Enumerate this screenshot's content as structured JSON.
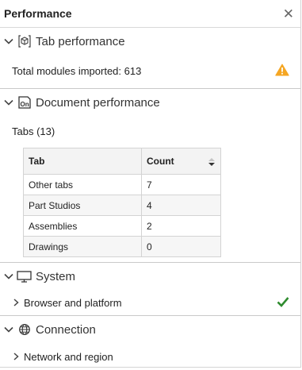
{
  "header": {
    "title": "Performance",
    "close_glyph": "✕"
  },
  "sections": {
    "tab_performance": {
      "label": "Tab performance",
      "modules_text": "Total modules imported: 613",
      "warning_color": "#f5a623"
    },
    "document_performance": {
      "label": "Document performance",
      "tabs_label": "Tabs (13)",
      "table": {
        "columns": [
          "Tab",
          "Count"
        ],
        "rows": [
          [
            "Other tabs",
            "7"
          ],
          [
            "Part Studios",
            "4"
          ],
          [
            "Assemblies",
            "2"
          ],
          [
            "Drawings",
            "0"
          ]
        ]
      }
    },
    "system": {
      "label": "System",
      "browser_label": "Browser and platform",
      "ok_color": "#2e8b2e"
    },
    "connection": {
      "label": "Connection",
      "network_label": "Network and region"
    }
  }
}
